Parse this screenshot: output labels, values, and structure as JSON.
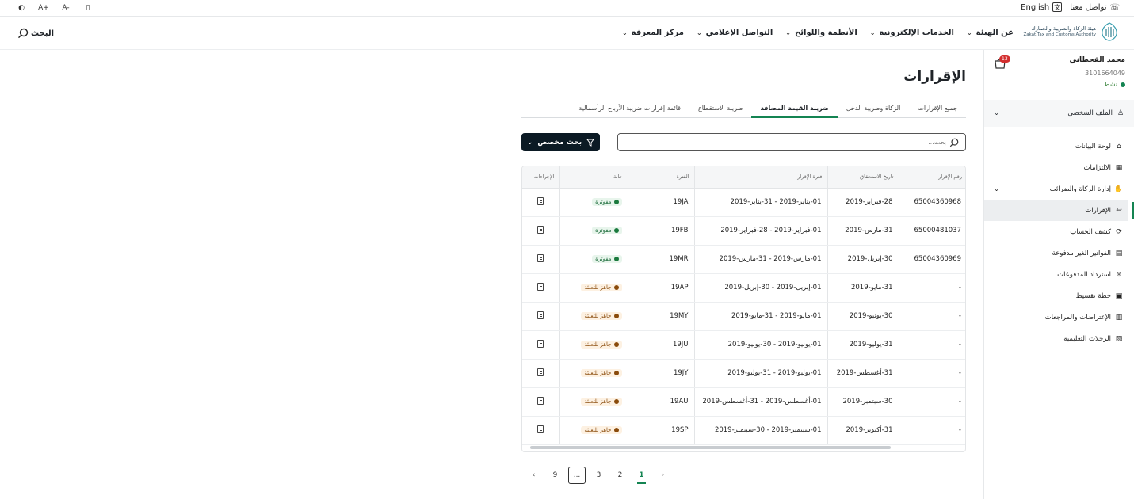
{
  "utility": {
    "contact": "تواصل معنا",
    "language": "English",
    "lang_glyph": "文",
    "font_increase": "A+",
    "font_decrease": "A-"
  },
  "logo": {
    "ar": "هيئة الزكاة والضريبة والجمارك",
    "en": "Zakat,Tax and Customs Authority"
  },
  "nav": {
    "items": [
      {
        "label": "عن الهيئة"
      },
      {
        "label": "الخدمات الإلكترونية"
      },
      {
        "label": "الأنظمة واللوائح"
      },
      {
        "label": "التواصل الإعلامي"
      },
      {
        "label": "مركز المعرفة"
      }
    ],
    "search_label": "البحث"
  },
  "profile": {
    "name": "محمد القحطاني",
    "id": "3101664049",
    "status": "نشط",
    "cart_count": "13",
    "file_label": "الملف الشخصي"
  },
  "sidebar": {
    "items": [
      {
        "label": "لوحة البيانات"
      },
      {
        "label": "الالتزامات"
      },
      {
        "label": "إدارة الزكاة والضرائب"
      },
      {
        "label": "الإقرارات"
      },
      {
        "label": "كشف الحساب"
      },
      {
        "label": "الفواتير الغير مدفوعة"
      },
      {
        "label": "استرداد المدفوعات"
      },
      {
        "label": "خطة تقسيط"
      },
      {
        "label": "الإعتراضات والمراجعات"
      },
      {
        "label": "الرحلات التعليمية"
      }
    ]
  },
  "page": {
    "title": "الإقرارات",
    "tabs": [
      {
        "label": "جميع الإقرارات"
      },
      {
        "label": "الزكاة وضريبة الدخل"
      },
      {
        "label": "ضريبة القيمة المضافة"
      },
      {
        "label": "ضريبة الاستقطاع"
      },
      {
        "label": "قائمة إقرارات ضريبة الأرباح الرأسمالية"
      }
    ],
    "search_placeholder": "بحث...",
    "custom_search": "بحث مخصص"
  },
  "table": {
    "headers": [
      "رقم الإقرار",
      "تاريخ الاستحقاق",
      "فترة الإقرار",
      "الفترة",
      "حالة",
      "الإجراءات"
    ],
    "rows": [
      {
        "number": "65004360968",
        "due": "28-فبراير-2019",
        "period": "01-يناير-2019 - 31-يناير-2019",
        "code": "19JA",
        "status": "مفوترة",
        "type": "paid"
      },
      {
        "number": "65000481037",
        "due": "31-مارس-2019",
        "period": "01-فبراير-2019 - 28-فبراير-2019",
        "code": "19FB",
        "status": "مفوترة",
        "type": "paid"
      },
      {
        "number": "65004360969",
        "due": "30-إبريل-2019",
        "period": "01-مارس-2019 - 31-مارس-2019",
        "code": "19MR",
        "status": "مفوترة",
        "type": "paid"
      },
      {
        "number": "-",
        "due": "31-مايو-2019",
        "period": "01-إبريل-2019 - 30-إبريل-2019",
        "code": "19AP",
        "status": "جاهز للتعبئة",
        "type": "ready"
      },
      {
        "number": "-",
        "due": "30-يونيو-2019",
        "period": "01-مايو-2019 - 31-مايو-2019",
        "code": "19MY",
        "status": "جاهز للتعبئة",
        "type": "ready"
      },
      {
        "number": "-",
        "due": "31-يوليو-2019",
        "period": "01-يونيو-2019 - 30-يونيو-2019",
        "code": "19JU",
        "status": "جاهز للتعبئة",
        "type": "ready"
      },
      {
        "number": "-",
        "due": "31-أغسطس-2019",
        "period": "01-يوليو-2019 - 31-يوليو-2019",
        "code": "19JY",
        "status": "جاهز للتعبئة",
        "type": "ready"
      },
      {
        "number": "-",
        "due": "30-سبتمبر-2019",
        "period": "01-أغسطس-2019 - 31-أغسطس-2019",
        "code": "19AU",
        "status": "جاهز للتعبئة",
        "type": "ready"
      },
      {
        "number": "-",
        "due": "31-أكتوبر-2019",
        "period": "01-سبتمبر-2019 - 30-سبتمبر-2019",
        "code": "19SP",
        "status": "جاهز للتعبئة",
        "type": "ready"
      }
    ]
  },
  "pagination": {
    "pages": [
      "1",
      "2",
      "3",
      "...",
      "9"
    ]
  },
  "colors": {
    "accent": "#148452",
    "paid_dot": "#1b7a3e",
    "ready_dot": "#8a4b0b",
    "button_dark": "#0b1a24"
  }
}
